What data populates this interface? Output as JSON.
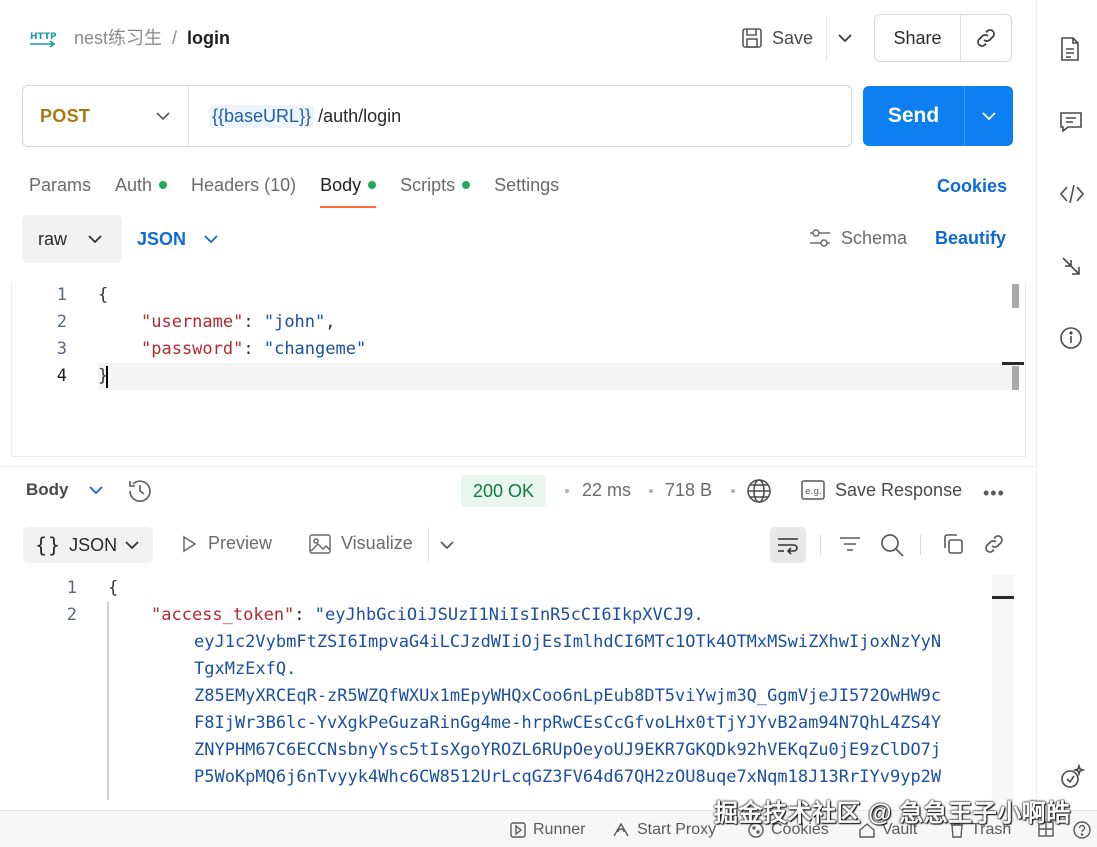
{
  "breadcrumb": {
    "collection": "nest练习生",
    "separator": "/",
    "request": "login"
  },
  "header": {
    "save_label": "Save",
    "share_label": "Share"
  },
  "request": {
    "method": "POST",
    "url_variable": "{{baseURL}}",
    "url_path": "/auth/login",
    "send_label": "Send"
  },
  "tabs": [
    {
      "label": "Params"
    },
    {
      "label": "Auth"
    },
    {
      "label": "Headers (10)"
    },
    {
      "label": "Body"
    },
    {
      "label": "Scripts"
    },
    {
      "label": "Settings"
    }
  ],
  "cookies_label": "Cookies",
  "body_options": {
    "mode": "raw",
    "language": "JSON",
    "schema_label": "Schema",
    "beautify_label": "Beautify"
  },
  "request_body": {
    "line_numbers": [
      "1",
      "2",
      "3",
      "4"
    ],
    "open_brace": "{",
    "close_brace": "}",
    "username_key": "\"username\"",
    "username_value": "\"john\"",
    "password_key": "\"password\"",
    "password_value": "\"changeme\""
  },
  "response": {
    "body_label": "Body",
    "status": "200 OK",
    "time": "22 ms",
    "size": "718 B",
    "save_response_label": "Save Response",
    "format_label": "JSON",
    "preview_label": "Preview",
    "visualize_label": "Visualize",
    "line_numbers": [
      "1",
      "2"
    ],
    "open_brace": "{",
    "token_key": "\"access_token\"",
    "token_lines": [
      "\"eyJhbGciOiJSUzI1NiIsInR5cCI6IkpXVCJ9.",
      "eyJ1c2VybmFtZSI6ImpvaG4iLCJzdWIiOjEsImlhdCI6MTc1OTk4OTMxMSwiZXhwIjoxNzYyN",
      "TgxMzExfQ.",
      "Z85EMyXRCEqR-zR5WZQfWXUx1mEpyWHQxCoo6nLpEub8DT5viYwjm3Q_GgmVjeJI572OwHW9c",
      "F8IjWr3B6lc-YvXgkPeGuzaRinGg4me-hrpRwCEsCcGfvoLHx0tTjYJYvB2am94N7QhL4ZS4Y",
      "ZNYPHM67C6ECCNsbnyYsc5tIsXgoYROZL6RUpOeyoUJ9EKR7GKQDk92hVEKqZu0jE9zClDO7j",
      "P5WoKpMQ6j6nTvyyk4Whc6CW8512UrLcqGZ3FV64d67QH2zOU8uqe7xNqm18J13RrIYv9yp2W"
    ]
  },
  "status_bar": {
    "runner": "Runner",
    "start_proxy": "Start Proxy",
    "cookies": "Cookies",
    "vault": "Vault",
    "trash": "Trash"
  },
  "watermark": "掘金技术社区 @ 急急王子小啊皓",
  "colors": {
    "accent": "#0c7ff2",
    "tab_active": "#ff6c37",
    "method": "#a67a12",
    "status_ok": "#117a3e"
  }
}
